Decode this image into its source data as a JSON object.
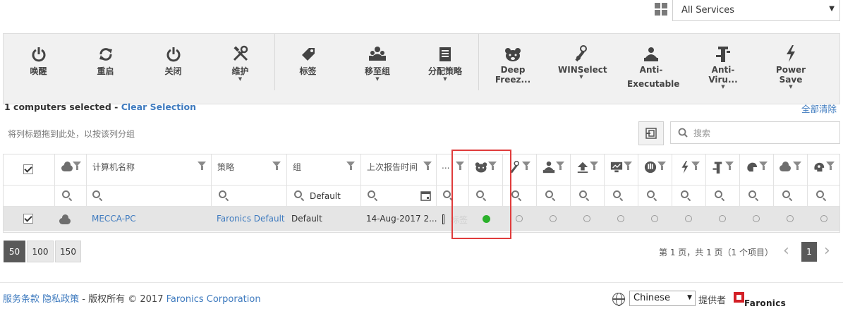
{
  "services": {
    "selected": "All Services"
  },
  "toolbar": {
    "buttons": [
      {
        "label": "唤醒",
        "icon": "power-icon"
      },
      {
        "label": "重启",
        "icon": "restart-icon"
      },
      {
        "label": "关闭",
        "icon": "shutdown-icon"
      },
      {
        "label": "维护",
        "icon": "tools-icon"
      },
      {
        "label": "标签",
        "icon": "tag-icon"
      },
      {
        "label": "移至组",
        "icon": "group-icon"
      },
      {
        "label": "分配策略",
        "icon": "policy-icon"
      },
      {
        "label": "Deep Freez...",
        "icon": "deep-freeze-icon"
      },
      {
        "label": "WINSelect",
        "icon": "winselect-icon"
      },
      {
        "label": "Anti-",
        "label2": "Executable",
        "icon": "anti-executable-icon"
      },
      {
        "label": "Anti-Viru...",
        "icon": "anti-virus-icon"
      },
      {
        "label": "Power Save",
        "icon": "power-save-icon"
      }
    ]
  },
  "selection": {
    "text": "1 computers selected - ",
    "clear": "Clear Selection",
    "clear_all": "全部清除"
  },
  "grid": {
    "group_hint": "将列标题拖到此处，以按该列分组",
    "search_placeholder": "搜索",
    "columns": {
      "name": "计算机名称",
      "policy": "策略",
      "group": "组",
      "last_report": "上次报告时间",
      "dots": "..."
    },
    "filters": {
      "group": "Default"
    },
    "row": {
      "name": "MECCA-PC",
      "policy": "Faronics Default",
      "group": "Default",
      "last_report": "14-Aug-2017 2...",
      "tag_ghost": "标签"
    }
  },
  "pager": {
    "sizes": [
      "50",
      "100",
      "150"
    ],
    "active_size": "50",
    "info": "第 1 页，共 1 页（1 个项目）",
    "current": "1"
  },
  "footer": {
    "terms": "服务条款",
    "privacy": "隐私政策",
    "copyright": " - 版权所有 © 2017 ",
    "company": "Faronics Corporation",
    "language": "Chinese",
    "provided_by": "提供者",
    "logo_text": "Faronics"
  },
  "colors": {
    "link": "#3f7bbf",
    "highlight": "#e03c3c",
    "status_online": "#2bb12b",
    "active_page": "#595959"
  }
}
